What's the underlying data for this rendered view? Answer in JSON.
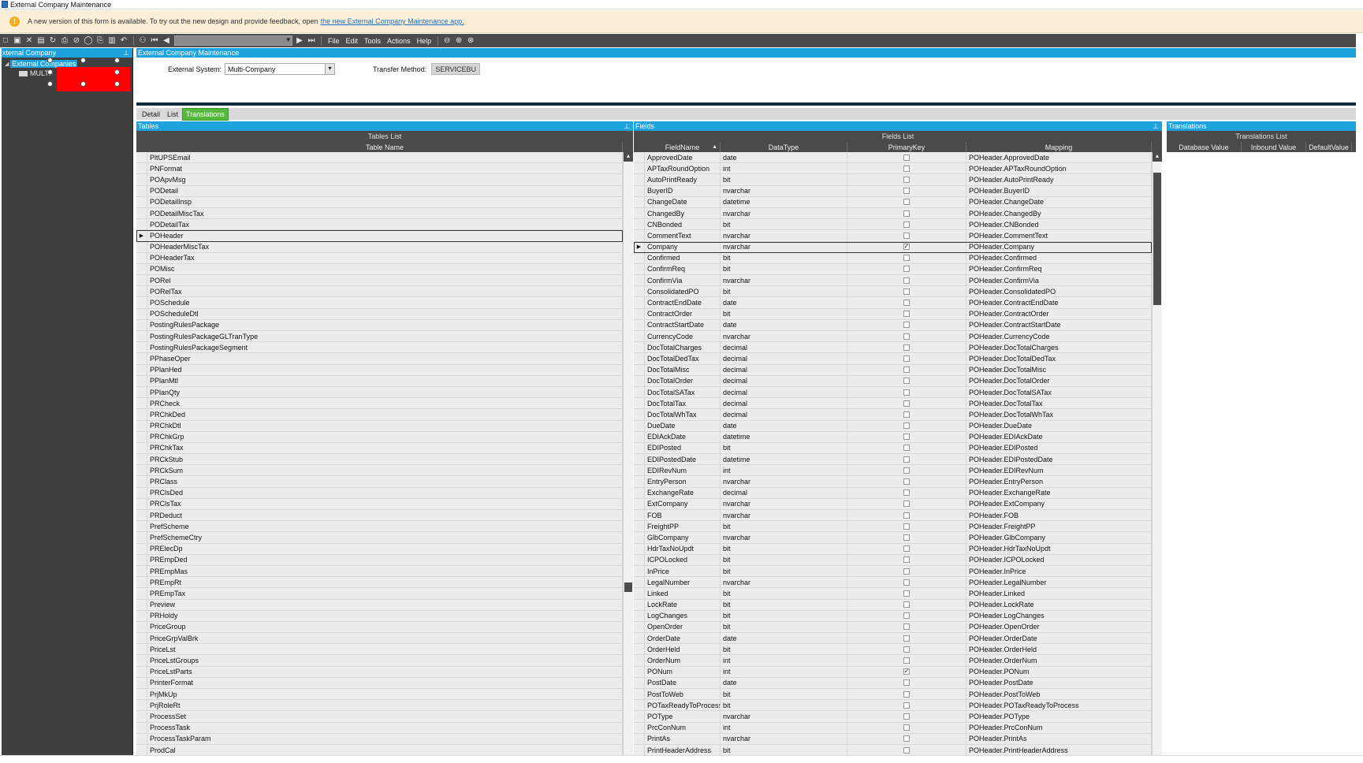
{
  "window": {
    "title": "External Company Maintenance"
  },
  "banner": {
    "message": "A new version of this form is available. To try out the new design and provide feedback, open",
    "link": "the new External Company Maintenance app."
  },
  "toolbar": {
    "menus": [
      "File",
      "Edit",
      "Tools",
      "Actions",
      "Help"
    ]
  },
  "left_panel": {
    "header": "xternal Company",
    "pin": "⊥",
    "tree_root": "External Companies",
    "tree_child": "MULTI-"
  },
  "main": {
    "header": "External Company Maintenance",
    "external_system_label": "External System:",
    "external_system_value": "Multi-Company",
    "transfer_method_label": "Transfer Method:",
    "transfer_method_value": "SERVICEBU"
  },
  "tabs": [
    {
      "label": "Detail",
      "active": false
    },
    {
      "label": "List",
      "active": false
    },
    {
      "label": "Translations",
      "active": true
    }
  ],
  "tables_panel": {
    "header": "Tables",
    "pin": "⊥",
    "list_title": "Tables List",
    "column": "Table Name",
    "selected": "POHeader",
    "scroll_thumb_fraction": 0.72,
    "rows": [
      "PltUPSEmail",
      "PNFormat",
      "POApvMsg",
      "PODetail",
      "PODetailInsp",
      "PODetailMiscTax",
      "PODetailTax",
      "POHeader",
      "POHeaderMiscTax",
      "POHeaderTax",
      "POMisc",
      "PORel",
      "PORelTax",
      "POSchedule",
      "POScheduleDtl",
      "PostingRulesPackage",
      "PostingRulesPackageGLTranType",
      "PostingRulesPackageSegment",
      "PPhaseOper",
      "PPlanHed",
      "PPlanMtl",
      "PPlanQty",
      "PRCheck",
      "PRChkDed",
      "PRChkDtl",
      "PRChkGrp",
      "PRChkTax",
      "PRCkStub",
      "PRCkSum",
      "PRClass",
      "PRClsDed",
      "PRClsTax",
      "PRDeduct",
      "PrefScheme",
      "PrefSchemeCtry",
      "PRElecDp",
      "PREmpDed",
      "PREmpMas",
      "PREmpRt",
      "PREmpTax",
      "Preview",
      "PRHoldy",
      "PriceGroup",
      "PriceGrpValBrk",
      "PriceLst",
      "PriceLstGroups",
      "PriceLstParts",
      "PrinterFormat",
      "PrjMkUp",
      "PrjRoleRt",
      "ProcessSet",
      "ProcessTask",
      "ProcessTaskParam",
      "ProdCal"
    ]
  },
  "fields_panel": {
    "header": "Fields",
    "pin": "⊥",
    "list_title": "Fields List",
    "columns": [
      "FieldName",
      "DataType",
      "PrimaryKey",
      "Mapping"
    ],
    "sort_indicator": "▲",
    "selected": "Company",
    "scroll_thumb_fraction": 0.22,
    "rows": [
      [
        "ApprovedDate",
        "date",
        false,
        "POHeader.ApprovedDate"
      ],
      [
        "APTaxRoundOption",
        "int",
        false,
        "POHeader.APTaxRoundOption"
      ],
      [
        "AutoPrintReady",
        "bit",
        false,
        "POHeader.AutoPrintReady"
      ],
      [
        "BuyerID",
        "nvarchar",
        false,
        "POHeader.BuyerID"
      ],
      [
        "ChangeDate",
        "datetime",
        false,
        "POHeader.ChangeDate"
      ],
      [
        "ChangedBy",
        "nvarchar",
        false,
        "POHeader.ChangedBy"
      ],
      [
        "CNBonded",
        "bit",
        false,
        "POHeader.CNBonded"
      ],
      [
        "CommentText",
        "nvarchar",
        false,
        "POHeader.CommentText"
      ],
      [
        "Company",
        "nvarchar",
        true,
        "POHeader.Company"
      ],
      [
        "Confirmed",
        "bit",
        false,
        "POHeader.Confirmed"
      ],
      [
        "ConfirmReq",
        "bit",
        false,
        "POHeader.ConfirmReq"
      ],
      [
        "ConfirmVia",
        "nvarchar",
        false,
        "POHeader.ConfirmVia"
      ],
      [
        "ConsolidatedPO",
        "bit",
        false,
        "POHeader.ConsolidatedPO"
      ],
      [
        "ContractEndDate",
        "date",
        false,
        "POHeader.ContractEndDate"
      ],
      [
        "ContractOrder",
        "bit",
        false,
        "POHeader.ContractOrder"
      ],
      [
        "ContractStartDate",
        "date",
        false,
        "POHeader.ContractStartDate"
      ],
      [
        "CurrencyCode",
        "nvarchar",
        false,
        "POHeader.CurrencyCode"
      ],
      [
        "DocTotalCharges",
        "decimal",
        false,
        "POHeader.DocTotalCharges"
      ],
      [
        "DocTotalDedTax",
        "decimal",
        false,
        "POHeader.DocTotalDedTax"
      ],
      [
        "DocTotalMisc",
        "decimal",
        false,
        "POHeader.DocTotalMisc"
      ],
      [
        "DocTotalOrder",
        "decimal",
        false,
        "POHeader.DocTotalOrder"
      ],
      [
        "DocTotalSATax",
        "decimal",
        false,
        "POHeader.DocTotalSATax"
      ],
      [
        "DocTotalTax",
        "decimal",
        false,
        "POHeader.DocTotalTax"
      ],
      [
        "DocTotalWhTax",
        "decimal",
        false,
        "POHeader.DocTotalWhTax"
      ],
      [
        "DueDate",
        "date",
        false,
        "POHeader.DueDate"
      ],
      [
        "EDIAckDate",
        "datetime",
        false,
        "POHeader.EDIAckDate"
      ],
      [
        "EDIPosted",
        "bit",
        false,
        "POHeader.EDIPosted"
      ],
      [
        "EDIPostedDate",
        "datetime",
        false,
        "POHeader.EDIPostedDate"
      ],
      [
        "EDIRevNum",
        "int",
        false,
        "POHeader.EDIRevNum"
      ],
      [
        "EntryPerson",
        "nvarchar",
        false,
        "POHeader.EntryPerson"
      ],
      [
        "ExchangeRate",
        "decimal",
        false,
        "POHeader.ExchangeRate"
      ],
      [
        "ExtCompany",
        "nvarchar",
        false,
        "POHeader.ExtCompany"
      ],
      [
        "FOB",
        "nvarchar",
        false,
        "POHeader.FOB"
      ],
      [
        "FreightPP",
        "bit",
        false,
        "POHeader.FreightPP"
      ],
      [
        "GlbCompany",
        "nvarchar",
        false,
        "POHeader.GlbCompany"
      ],
      [
        "HdrTaxNoUpdt",
        "bit",
        false,
        "POHeader.HdrTaxNoUpdt"
      ],
      [
        "ICPOLocked",
        "bit",
        false,
        "POHeader.ICPOLocked"
      ],
      [
        "InPrice",
        "bit",
        false,
        "POHeader.InPrice"
      ],
      [
        "LegalNumber",
        "nvarchar",
        false,
        "POHeader.LegalNumber"
      ],
      [
        "Linked",
        "bit",
        false,
        "POHeader.Linked"
      ],
      [
        "LockRate",
        "bit",
        false,
        "POHeader.LockRate"
      ],
      [
        "LogChanges",
        "bit",
        false,
        "POHeader.LogChanges"
      ],
      [
        "OpenOrder",
        "bit",
        false,
        "POHeader.OpenOrder"
      ],
      [
        "OrderDate",
        "date",
        false,
        "POHeader.OrderDate"
      ],
      [
        "OrderHeld",
        "bit",
        false,
        "POHeader.OrderHeld"
      ],
      [
        "OrderNum",
        "int",
        false,
        "POHeader.OrderNum"
      ],
      [
        "PONum",
        "int",
        true,
        "POHeader.PONum"
      ],
      [
        "PostDate",
        "date",
        false,
        "POHeader.PostDate"
      ],
      [
        "PostToWeb",
        "bit",
        false,
        "POHeader.PostToWeb"
      ],
      [
        "POTaxReadyToProcess",
        "bit",
        false,
        "POHeader.POTaxReadyToProcess"
      ],
      [
        "POType",
        "nvarchar",
        false,
        "POHeader.POType"
      ],
      [
        "PrcConNum",
        "int",
        false,
        "POHeader.PrcConNum"
      ],
      [
        "PrintAs",
        "nvarchar",
        false,
        "POHeader.PrintAs"
      ],
      [
        "PrintHeaderAddress",
        "bit",
        false,
        "POHeader.PrintHeaderAddress"
      ]
    ]
  },
  "translations_panel": {
    "header": "Translations",
    "list_title": "Translations List",
    "columns": [
      "Database Value",
      "Inbound Value",
      "DefaultValue"
    ]
  }
}
